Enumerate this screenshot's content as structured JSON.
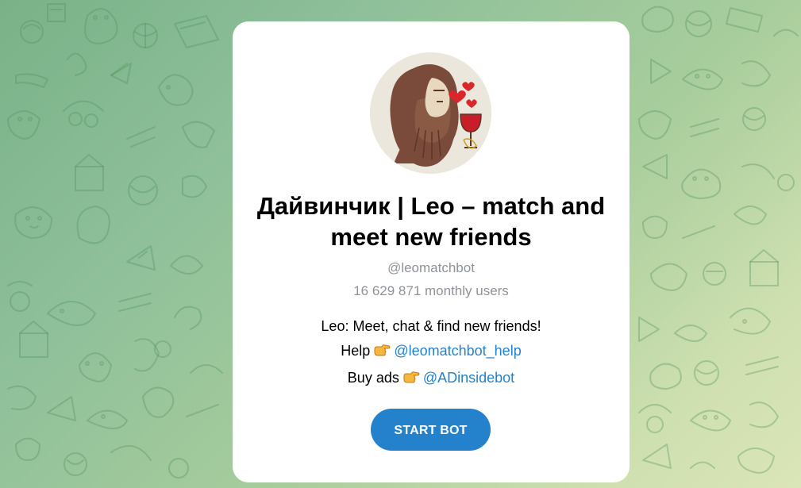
{
  "bot": {
    "title": "Дайвинчик | Leo – match and meet new friends",
    "username": "@leomatchbot",
    "monthly_users": "16 629 871 monthly users",
    "description": {
      "line1": "Leo: Meet, chat & find new friends!",
      "help_label": "Help",
      "help_link": "@leomatchbot_help",
      "ads_label": "Buy ads",
      "ads_link": "@ADinsidebot"
    },
    "start_label": "START BOT"
  },
  "icons": {
    "pointing_emoji": "backhand-index-pointing-right-icon",
    "avatar": "leonardo-portrait-with-hearts-and-wine"
  },
  "colors": {
    "accent": "#2481cc",
    "muted_text": "#8e9399",
    "card_bg": "#ffffff"
  }
}
